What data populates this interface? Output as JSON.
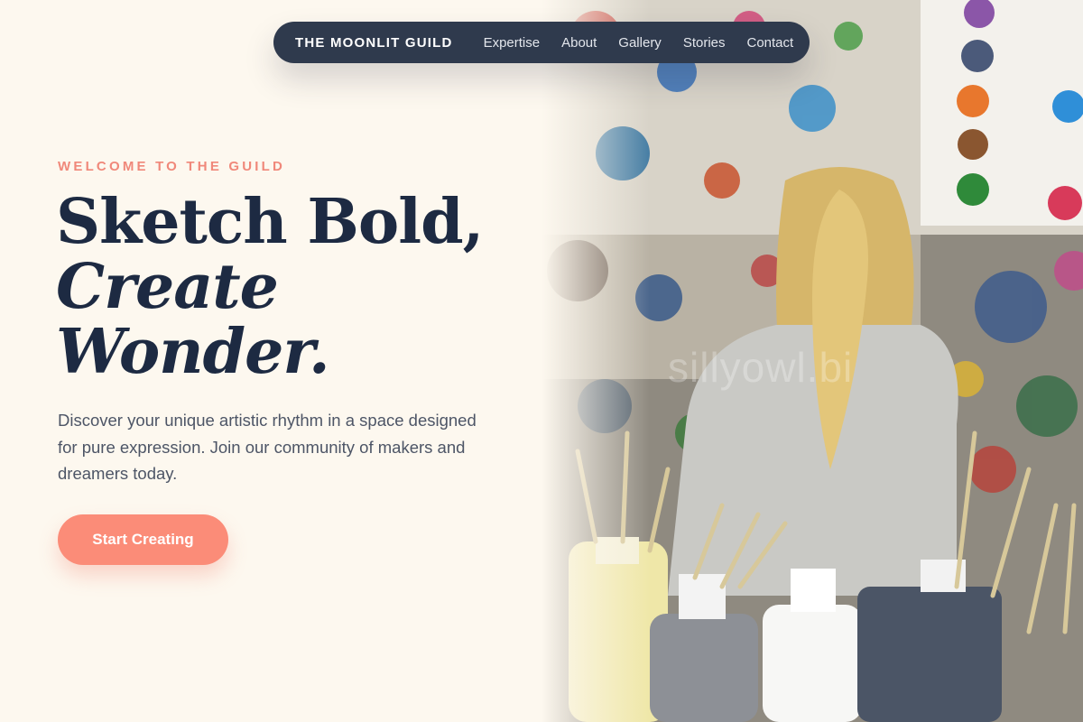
{
  "nav": {
    "brand": "THE MOONLIT GUILD",
    "links": [
      "Expertise",
      "About",
      "Gallery",
      "Stories",
      "Contact"
    ]
  },
  "hero": {
    "eyebrow": "WELCOME TO THE GUILD",
    "headline_line1": "Sketch Bold,",
    "headline_line2": "Create",
    "headline_line3": "Wonder.",
    "description": "Discover your unique artistic rhythm in a space designed for pure expression. Join our community of makers and dreamers today.",
    "cta_label": "Start Creating",
    "image_watermark": "sillyowl.bi"
  },
  "colors": {
    "background": "#fdf8ef",
    "nav_background": "#2f3a4d",
    "accent": "#fb8c78",
    "eyebrow": "#f0887a",
    "headline": "#1d2a42",
    "body_text": "#4d5566"
  }
}
